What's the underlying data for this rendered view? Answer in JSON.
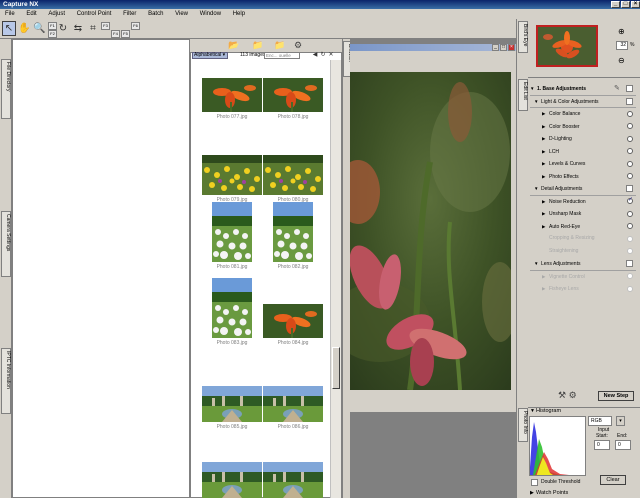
{
  "app": {
    "title": "Capture NX"
  },
  "window_buttons": [
    "_",
    "□",
    "×"
  ],
  "menu": [
    "File",
    "Edit",
    "Adjust",
    "Control Point",
    "Filter",
    "Batch",
    "View",
    "Window",
    "Help"
  ],
  "toolbar": {
    "tools": [
      "direct-select-tool",
      "hand-tool",
      "zoom-tool",
      "rotate-tool",
      "straighten-tool",
      "crop-tool"
    ],
    "fkeys": [
      "F1",
      "F2",
      "F3",
      "F4",
      "F5",
      "F6"
    ]
  },
  "left_tabs": [
    "File Directory",
    "Camera Settings",
    "IPTC Information"
  ],
  "browser": {
    "tab_label": "Browser",
    "sort_label": "Alphabetical",
    "image_count": "113 images",
    "search_placeholder": "Enc... ouelle",
    "thumbnails": [
      {
        "caption": "Photo 077.jpg",
        "kind": "lily"
      },
      {
        "caption": "Photo 078.jpg",
        "kind": "lily"
      },
      {
        "caption": "Photo 079.jpg",
        "kind": "yellow"
      },
      {
        "caption": "Photo 080.jpg",
        "kind": "yellow"
      },
      {
        "caption": "Photo 081.jpg",
        "kind": "white"
      },
      {
        "caption": "Photo 082.jpg",
        "kind": "white"
      },
      {
        "caption": "Photo 083.jpg",
        "kind": "white"
      },
      {
        "caption": "Photo 084.jpg",
        "kind": "lily"
      },
      {
        "caption": "Photo 085.jpg",
        "kind": "park"
      },
      {
        "caption": "Photo 086.jpg",
        "kind": "park"
      },
      {
        "caption": "Photo 087.jpg",
        "kind": "park"
      },
      {
        "caption": "Photo 088.jpg",
        "kind": "park"
      }
    ]
  },
  "right_tabs": [
    "Bird's Eye",
    "Edit List",
    "Photo Info"
  ],
  "birds_eye": {
    "zoom": "32",
    "zoom_unit": "%"
  },
  "edit_list": {
    "rows": [
      {
        "label": "1. Base Adjustments",
        "level": 0,
        "type": "header",
        "dim": false
      },
      {
        "label": "Light & Color Adjustments",
        "level": 1,
        "type": "group",
        "dim": false
      },
      {
        "label": "Color Balance",
        "level": 2,
        "type": "item",
        "dim": false
      },
      {
        "label": "Color Booster",
        "level": 2,
        "type": "item",
        "dim": false
      },
      {
        "label": "D-Lighting",
        "level": 2,
        "type": "item",
        "dim": false
      },
      {
        "label": "LCH",
        "level": 2,
        "type": "item",
        "dim": false
      },
      {
        "label": "Levels & Curves",
        "level": 2,
        "type": "item",
        "dim": false
      },
      {
        "label": "Photo Effects",
        "level": 2,
        "type": "item",
        "dim": false
      },
      {
        "label": "Detail Adjustments",
        "level": 1,
        "type": "group",
        "dim": false
      },
      {
        "label": "Noise Reduction",
        "level": 2,
        "type": "item",
        "dim": false,
        "checked": true
      },
      {
        "label": "Unsharp Mask",
        "level": 2,
        "type": "item",
        "dim": false
      },
      {
        "label": "Auto Red-Eye",
        "level": 2,
        "type": "item",
        "dim": false
      },
      {
        "label": "Cropping & Resizing",
        "level": 2,
        "type": "plain",
        "dim": true
      },
      {
        "label": "Straightening",
        "level": 2,
        "type": "plain",
        "dim": true
      },
      {
        "label": "Lens Adjustments",
        "level": 1,
        "type": "group",
        "dim": false
      },
      {
        "label": "Vignette Control",
        "level": 2,
        "type": "item",
        "dim": true
      },
      {
        "label": "Fisheye Lens",
        "level": 2,
        "type": "item",
        "dim": true
      }
    ],
    "new_step_label": "New Step"
  },
  "histogram": {
    "title": "Histogram",
    "channel": "RGB",
    "input_label": "Input",
    "start_label": "Start:",
    "end_label": "End:",
    "start_value": "0",
    "end_value": "0",
    "double_threshold_label": "Double Threshold",
    "clear_label": "Clear"
  },
  "watch_points": {
    "title": "Watch Points"
  },
  "colors": {
    "title_start": "#0a246a",
    "title_end": "#3a6ea5",
    "sort_bg": "#aab8d8",
    "accent_red": "#c02020"
  }
}
